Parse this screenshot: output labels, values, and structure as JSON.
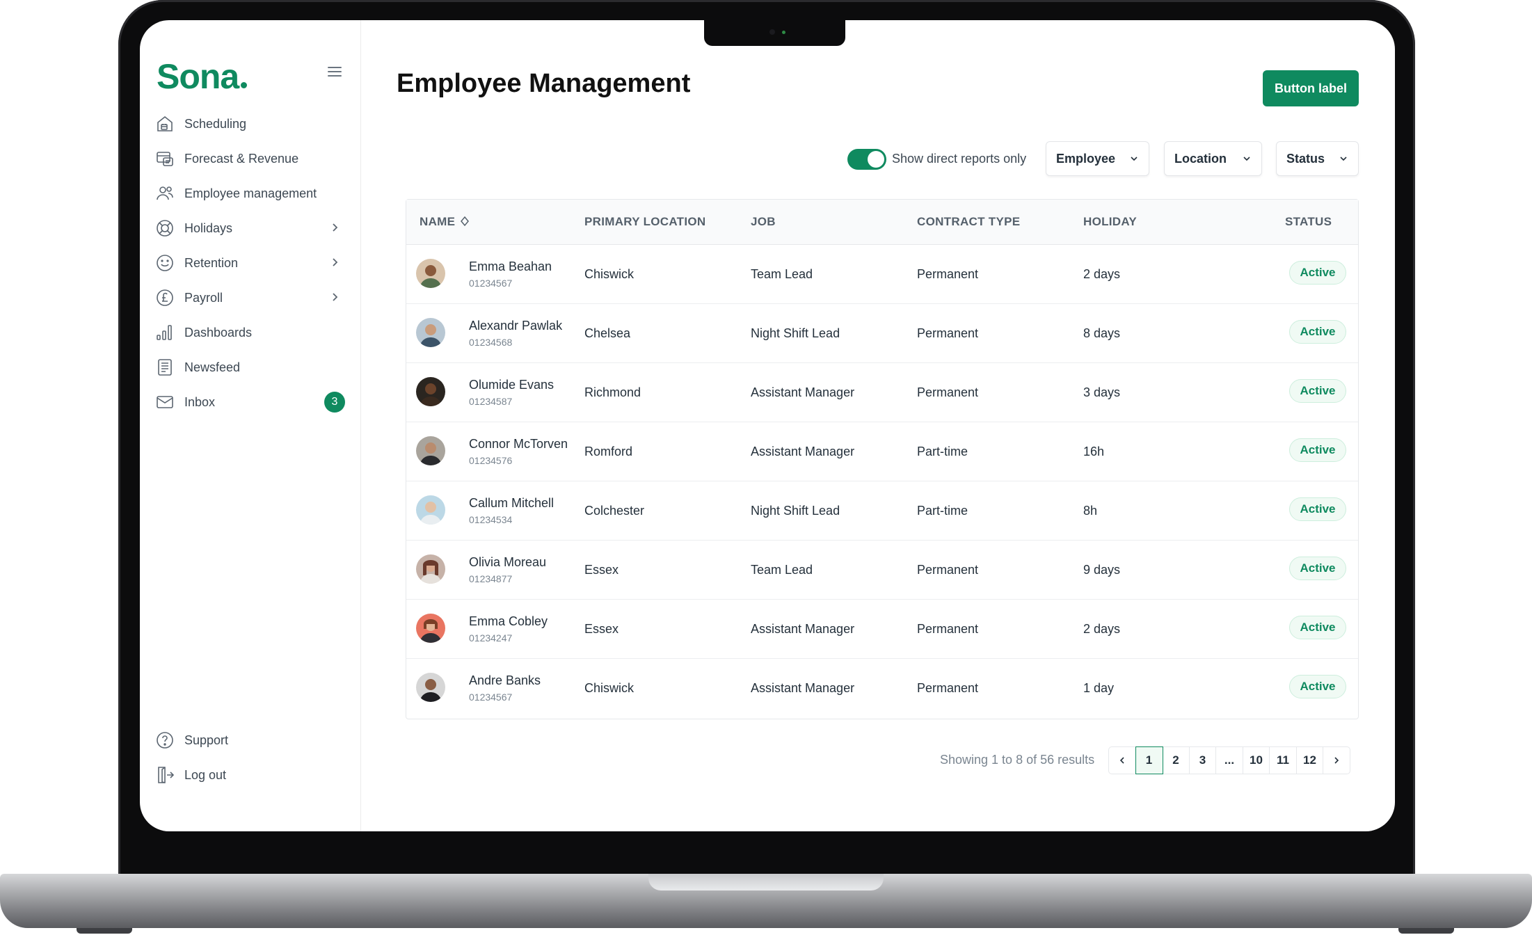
{
  "brand": {
    "name": "Sona",
    "color": "#0f8a5f"
  },
  "sidebar": {
    "items": [
      {
        "label": "Scheduling",
        "icon": "home-calendar-icon"
      },
      {
        "label": "Forecast & Revenue",
        "icon": "forecast-icon"
      },
      {
        "label": "Employee management",
        "icon": "users-icon"
      },
      {
        "label": "Holidays",
        "icon": "lifebuoy-icon",
        "has_submenu": true
      },
      {
        "label": "Retention",
        "icon": "smile-icon",
        "has_submenu": true
      },
      {
        "label": "Payroll",
        "icon": "pound-icon",
        "has_submenu": true
      },
      {
        "label": "Dashboards",
        "icon": "bar-chart-icon"
      },
      {
        "label": "Newsfeed",
        "icon": "newsfeed-icon"
      },
      {
        "label": "Inbox",
        "icon": "mail-icon",
        "badge": "3"
      }
    ],
    "bottom": [
      {
        "label": "Support",
        "icon": "question-icon"
      },
      {
        "label": "Log out",
        "icon": "logout-icon"
      }
    ]
  },
  "header": {
    "title": "Employee Management",
    "button_label": "Button label"
  },
  "filters": {
    "toggle_label": "Show direct reports only",
    "toggle_on": true,
    "dropdowns": [
      "Employee",
      "Location",
      "Status"
    ]
  },
  "table": {
    "columns": [
      "NAME",
      "PRIMARY LOCATION",
      "JOB",
      "CONTRACT TYPE",
      "HOLIDAY",
      "STATUS"
    ],
    "rows": [
      {
        "name": "Emma Beahan",
        "id": "01234567",
        "location": "Chiswick",
        "job": "Team Lead",
        "contract": "Permanent",
        "holiday": "2 days",
        "status": "Active"
      },
      {
        "name": "Alexandr Pawlak",
        "id": "01234568",
        "location": "Chelsea",
        "job": "Night Shift Lead",
        "contract": "Permanent",
        "holiday": "8 days",
        "status": "Active"
      },
      {
        "name": "Olumide Evans",
        "id": "01234587",
        "location": "Richmond",
        "job": "Assistant Manager",
        "contract": "Permanent",
        "holiday": "3 days",
        "status": "Active"
      },
      {
        "name": "Connor McTorven",
        "id": "01234576",
        "location": "Romford",
        "job": "Assistant Manager",
        "contract": "Part-time",
        "holiday": "16h",
        "status": "Active"
      },
      {
        "name": "Callum Mitchell",
        "id": "01234534",
        "location": "Colchester",
        "job": "Night Shift Lead",
        "contract": "Part-time",
        "holiday": "8h",
        "status": "Active"
      },
      {
        "name": "Olivia Moreau",
        "id": "01234877",
        "location": "Essex",
        "job": "Team Lead",
        "contract": "Permanent",
        "holiday": "9 days",
        "status": "Active"
      },
      {
        "name": "Emma Cobley",
        "id": "01234247",
        "location": "Essex",
        "job": "Assistant Manager",
        "contract": "Permanent",
        "holiday": "2 days",
        "status": "Active"
      },
      {
        "name": "Andre Banks",
        "id": "01234567",
        "location": "Chiswick",
        "job": "Assistant Manager",
        "contract": "Permanent",
        "holiday": "1 day",
        "status": "Active"
      }
    ]
  },
  "pagination": {
    "summary": "Showing 1 to 8 of 56 results",
    "pages": [
      "1",
      "2",
      "3",
      "...",
      "10",
      "11",
      "12"
    ],
    "current": "1"
  }
}
